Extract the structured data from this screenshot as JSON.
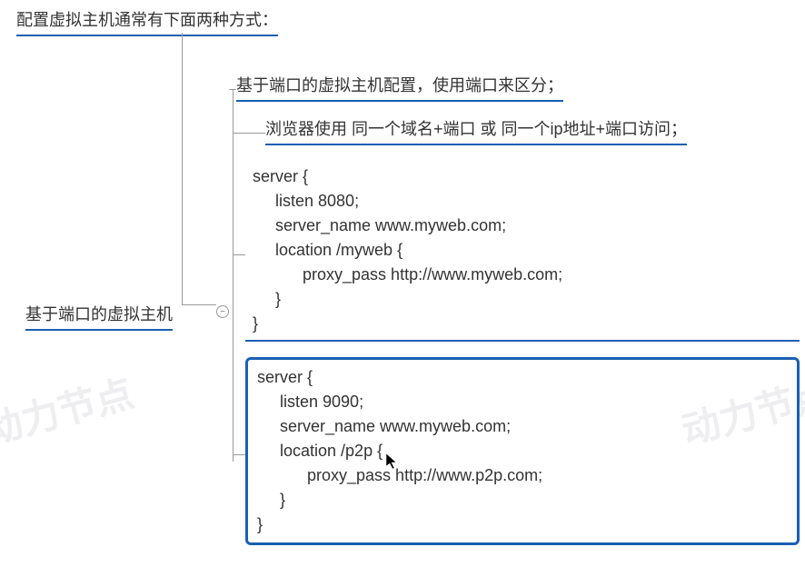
{
  "root": {
    "title": "配置虚拟主机通常有下面两种方式："
  },
  "mid": {
    "title": "基于端口的虚拟主机"
  },
  "sub1": {
    "text": "基于端口的虚拟主机配置，使用端口来区分；"
  },
  "sub2": {
    "text": "浏览器使用 同一个域名+端口 或 同一个ip地址+端口访问；"
  },
  "code1": "server {\n     listen 8080;\n     server_name www.myweb.com;\n     location /myweb {\n           proxy_pass http://www.myweb.com;\n     }\n}",
  "code2": "server {\n     listen 9090;\n     server_name www.myweb.com;\n     location /p2p {\n           proxy_pass http://www.p2p.com;\n     }\n}",
  "collapse": {
    "symbol": "−"
  },
  "watermark": "动力节点"
}
